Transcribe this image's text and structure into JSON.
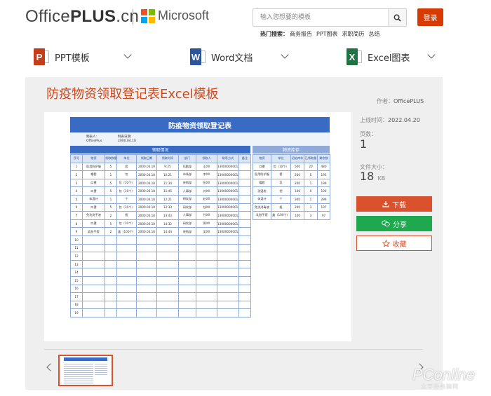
{
  "header": {
    "logo_office": "Office",
    "logo_plus": "PLUS",
    "logo_cn": ".cn",
    "ms_text": "Microsoft",
    "search_placeholder": "输入您想要的模板",
    "login_label": "登录",
    "hot_label": "热门搜索：",
    "hot_items": [
      "商务报告",
      "PPT图表",
      "求职简历",
      "总结"
    ]
  },
  "nav": [
    {
      "label": "PPT模板",
      "icon": "P",
      "color": "#c43e1c"
    },
    {
      "label": "Word文档",
      "icon": "W",
      "color": "#2b579a"
    },
    {
      "label": "Excel图表",
      "icon": "X",
      "color": "#217346"
    }
  ],
  "template": {
    "title": "防疫物资领取登记表Excel模板",
    "author_label": "作者：",
    "author": "OfficePLUS",
    "date_label": "上线时间：",
    "date": "2022.04.20",
    "pages_label": "页数：",
    "pages": "1",
    "size_label": "文件大小：",
    "size": "18",
    "size_unit": "KB",
    "download_label": "下载",
    "share_label": "分享",
    "fav_label": "收藏"
  },
  "sheet": {
    "title": "防疫物资领取登记表",
    "stat_label": "制表人:",
    "stat_value": "OfficePlus",
    "date_label": "制表日期:",
    "date_value": "2000.04.10",
    "left_section": "领取情况",
    "right_section": "物资库存",
    "left_headers": [
      "序号",
      "物资",
      "领取数量",
      "单位",
      "领取日期",
      "领取时间",
      "部门",
      "领取人",
      "联系方式",
      "备注"
    ],
    "left_rows": [
      [
        "1",
        "医用防护服",
        "5",
        "套",
        "2000.04.18",
        "9:25",
        "后勤部",
        "王XX",
        "13000000001234",
        ""
      ],
      [
        "2",
        "帽套",
        "1",
        "包",
        "2000.04.18",
        "10:21",
        "市场部",
        "李XX",
        "13000000001235",
        ""
      ],
      [
        "3",
        "口罩",
        "5",
        "包（10个）",
        "2000.04.18",
        "11:34",
        "采购部",
        "张XX",
        "13000000001236",
        ""
      ],
      [
        "4",
        "口罩",
        "5",
        "包（10个）",
        "2000.04.18",
        "11:45",
        "人事部",
        "刘XX",
        "13000000001237",
        ""
      ],
      [
        "5",
        "体温计",
        "1",
        "个",
        "2000.04.18",
        "12:21",
        "研发部",
        "赵XX",
        "13000000001238",
        ""
      ],
      [
        "6",
        "口罩",
        "5",
        "包（10个）",
        "2000.04.18",
        "12:33",
        "研发部",
        "钱XX",
        "13000000001239",
        ""
      ],
      [
        "7",
        "免洗洗手液",
        "2",
        "瓶",
        "2000.04.18",
        "13:43",
        "人事部",
        "孙XX",
        "13000000001240",
        ""
      ],
      [
        "8",
        "口罩",
        "5",
        "包（10个）",
        "2000.04.18",
        "14:32",
        "研发部",
        "周XX",
        "13000000001241",
        ""
      ],
      [
        "9",
        "乳胶手套",
        "2",
        "盒（100个）",
        "2000.04.18",
        "14:44",
        "采购部",
        "吴XX",
        "13000000001242",
        ""
      ],
      [
        "10",
        "",
        "",
        "",
        "",
        "",
        "",
        "",
        "",
        ""
      ],
      [
        "11",
        "",
        "",
        "",
        "",
        "",
        "",
        "",
        "",
        ""
      ],
      [
        "12",
        "",
        "",
        "",
        "",
        "",
        "",
        "",
        "",
        ""
      ],
      [
        "13",
        "",
        "",
        "",
        "",
        "",
        "",
        "",
        "",
        ""
      ],
      [
        "14",
        "",
        "",
        "",
        "",
        "",
        "",
        "",
        "",
        ""
      ],
      [
        "15",
        "",
        "",
        "",
        "",
        "",
        "",
        "",
        "",
        ""
      ],
      [
        "16",
        "",
        "",
        "",
        "",
        "",
        "",
        "",
        "",
        ""
      ],
      [
        "17",
        "",
        "",
        "",
        "",
        "",
        "",
        "",
        "",
        ""
      ],
      [
        "18",
        "",
        "",
        "",
        "",
        "",
        "",
        "",
        "",
        ""
      ],
      [
        "19",
        "",
        "",
        "",
        "",
        "",
        "",
        "",
        "",
        ""
      ]
    ],
    "right_headers": [
      "物资",
      "单位",
      "初始库存",
      "已领取量",
      "剩余数"
    ],
    "right_rows": [
      [
        "口罩",
        "包（10个）",
        "500",
        "20",
        "480"
      ],
      [
        "医用防护服",
        "套",
        "200",
        "5",
        "195"
      ],
      [
        "帽套",
        "包",
        "200",
        "1",
        "199"
      ],
      [
        "测温枪",
        "把",
        "100",
        "0",
        "100"
      ],
      [
        "体温计",
        "个",
        "300",
        "1",
        "299"
      ],
      [
        "免洗消毒液",
        "瓶",
        "200",
        "3",
        "197"
      ],
      [
        "乳胶手套",
        "盒（100个）",
        "100",
        "3",
        "97"
      ]
    ]
  },
  "watermark": {
    "text": "PConline",
    "sub": "太平洋电脑网"
  }
}
